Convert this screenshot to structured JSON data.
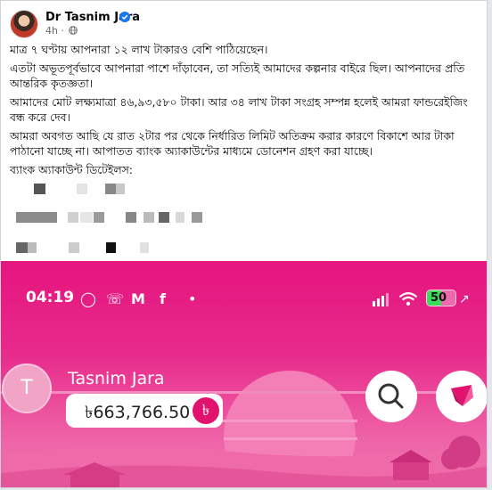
{
  "post": {
    "author": "Dr Tasnim Jara",
    "time": "4h",
    "paragraphs": [
      "মাত্র ৭ ঘণ্টায় আপনারা ১২ লাখ টাকারও বেশি পাঠিয়েছেন।",
      "এতটা অভূতপূর্বভাবে আপনারা পাশে দাঁড়াবেন, তা সত্যিই আমাদের কল্পনার বাইরে ছিল। আপনাদের প্রতি আন্তরিক কৃতজ্ঞতা।",
      "আমাদের মোট লক্ষ্যমাত্রা ৪৬,৯৩,৫৮০ টাকা। আর ৩৪ লাখ টাকা সংগ্রহ সম্পন্ন হলেই আমরা ফান্ডরেইজিং বন্ধ করে দেব।",
      "আমরা অবগত আছি যে রাত ২টার পর থেকে নির্ধারিত লিমিট অতিক্রম করার কারণে বিকাশে আর টাকা পাঠানো যাচ্ছে না। আপাতত ব্যাংক অ্যাকাউন্টের মাধ্যমে ডোনেশন গ্রহণ করা যাচ্ছে।",
      "ব্যাংক অ্যাকাউন্ট ডিটেইলস:"
    ]
  },
  "phone": {
    "clock": "04:19",
    "battery": "50",
    "battery_level": 0.5,
    "user_name": "Tasnim Jara",
    "initial": "T",
    "balance": "৳663,766.50",
    "taka_symbol": "৳"
  },
  "colors": {
    "accent": "#e2136e",
    "verified": "#1877f2"
  }
}
